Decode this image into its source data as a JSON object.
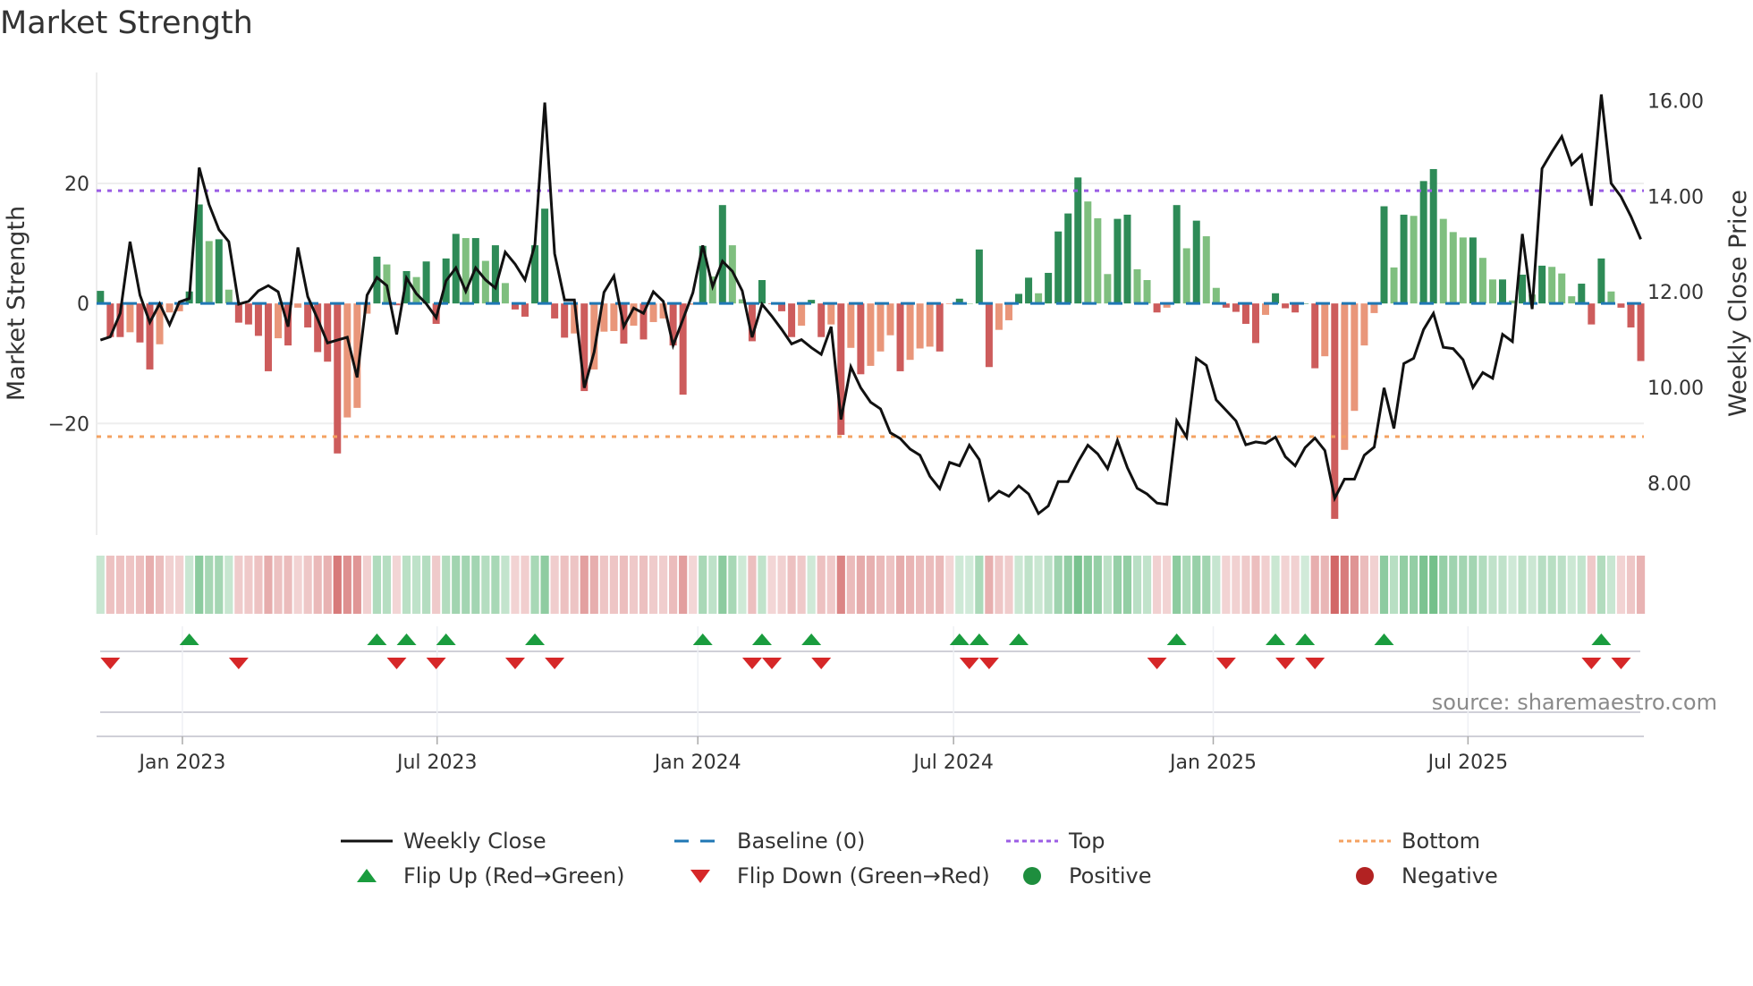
{
  "title": "Market Strength",
  "source": "source: sharemaestro.com",
  "colors": {
    "pos_rising": "#2e8b57",
    "pos_falling": "#7fbf7f",
    "neg_falling": "#cd5c5c",
    "neg_rising": "#e9967a",
    "line": "#111111",
    "baseline": "#1f77b4",
    "top": "#9b5de5",
    "bottom": "#f4a261",
    "flip_up": "#1a9c3e",
    "flip_down": "#d62728",
    "positive": "#1e8e3e",
    "negative": "#b22222"
  },
  "chart_data": {
    "type": "bar+line",
    "title": "Market Strength",
    "ylabel": "Market Strength",
    "y2label": "Weekly Close Price",
    "ylim": [
      -38.6,
      38.5
    ],
    "y2lim": [
      6.91,
      16.59
    ],
    "yticks": [
      {
        "v": 20,
        "label": "20"
      },
      {
        "v": 0,
        "label": "0"
      },
      {
        "v": -20,
        "label": "−20"
      }
    ],
    "y2ticks": [
      {
        "v": 16,
        "label": "16.00"
      },
      {
        "v": 14,
        "label": "14.00"
      },
      {
        "v": 12,
        "label": "12.00"
      },
      {
        "v": 10,
        "label": "10.00"
      },
      {
        "v": 8,
        "label": "8.00"
      }
    ],
    "xticks": [
      {
        "week": 8.3,
        "label": "Jan 2023"
      },
      {
        "week": 34.1,
        "label": "Jul 2023"
      },
      {
        "week": 60.5,
        "label": "Jan 2024"
      },
      {
        "week": 86.4,
        "label": "Jul 2024"
      },
      {
        "week": 112.7,
        "label": "Jan 2025"
      },
      {
        "week": 138.5,
        "label": "Jul 2025"
      }
    ],
    "top_threshold": 18.8,
    "bottom_threshold": -22.2,
    "strength": [
      2.1,
      -5.6,
      -5.6,
      -4.8,
      -6.5,
      -11,
      -6.8,
      -1.5,
      -1.3,
      2,
      16.5,
      10.4,
      10.7,
      2.3,
      -3.2,
      -3.5,
      -5.4,
      -11.3,
      -5.8,
      -7,
      -0.7,
      -4,
      -8.1,
      -9.7,
      -25,
      -19,
      -17.4,
      -1.7,
      7.8,
      6.5,
      -0.3,
      5.4,
      4.4,
      7,
      -3.4,
      7.5,
      11.6,
      10.9,
      10.9,
      7.1,
      9.7,
      3.4,
      -1,
      -2.2,
      9.7,
      15.8,
      -2.5,
      -5.7,
      -5,
      -14.6,
      -11,
      -4.7,
      -4.6,
      -6.7,
      -3.7,
      -6,
      -3.1,
      -2.5,
      -7,
      -15.2,
      -0.2,
      9.6,
      4.5,
      16.4,
      9.7,
      0.7,
      -6.3,
      3.9,
      -0.1,
      -1.3,
      -5.6,
      -3.7,
      0.6,
      -5.6,
      -3.5,
      -21.9,
      -7.4,
      -11.8,
      -10.4,
      -8,
      -5.3,
      -11.3,
      -9.4,
      -7.5,
      -7.2,
      -8,
      -0.1,
      0.8,
      0,
      9,
      -10.6,
      -4.4,
      -2.8,
      1.6,
      4.3,
      1.7,
      5.1,
      12,
      15,
      21,
      17,
      14.2,
      4.9,
      14.1,
      14.8,
      5.7,
      3.9,
      -1.5,
      -0.7,
      16.4,
      9.2,
      13.8,
      11.2,
      2.6,
      -0.7,
      -1.4,
      -3.4,
      -6.6,
      -1.9,
      1.7,
      -0.8,
      -1.5,
      0,
      -10.8,
      -8.8,
      -35.9,
      -24.4,
      -17.9,
      -7,
      -1.6,
      16.2,
      6,
      14.8,
      14.6,
      20.4,
      22.4,
      14.1,
      11.9,
      11,
      11,
      7.6,
      4,
      4,
      0.5,
      4.8,
      1.5,
      6.3,
      6.1,
      5,
      1.2,
      3.3,
      -3.5,
      7.5,
      2,
      -0.7,
      -4,
      -9.6
    ],
    "weekly_close": [
      10.99,
      11.06,
      11.55,
      13.05,
      11.93,
      11.36,
      11.75,
      11.31,
      11.79,
      11.86,
      14.6,
      13.83,
      13.3,
      13.05,
      11.74,
      11.8,
      12.02,
      12.13,
      12.0,
      11.27,
      12.93,
      11.9,
      11.43,
      10.93,
      10.99,
      11.05,
      10.21,
      11.93,
      12.3,
      12.13,
      11.11,
      12.29,
      11.96,
      11.75,
      11.46,
      12.23,
      12.5,
      12.01,
      12.5,
      12.25,
      12.08,
      12.83,
      12.58,
      12.25,
      12.99,
      15.96,
      12.8,
      11.83,
      11.83,
      9.99,
      10.74,
      11.99,
      12.33,
      11.27,
      11.66,
      11.55,
      12.0,
      11.8,
      10.88,
      11.43,
      11.98,
      12.97,
      12.11,
      12.64,
      12.43,
      12.02,
      11.05,
      11.74,
      11.49,
      11.21,
      10.91,
      11.0,
      10.83,
      10.69,
      11.27,
      9.33,
      10.43,
      9.99,
      9.69,
      9.55,
      9.05,
      8.93,
      8.71,
      8.58,
      8.14,
      7.88,
      8.43,
      8.36,
      8.79,
      8.49,
      7.64,
      7.83,
      7.72,
      7.94,
      7.77,
      7.36,
      7.52,
      8.03,
      8.03,
      8.44,
      8.79,
      8.61,
      8.3,
      8.89,
      8.32,
      7.89,
      7.77,
      7.58,
      7.55,
      9.3,
      8.96,
      10.61,
      10.46,
      9.74,
      9.52,
      9.3,
      8.8,
      8.86,
      8.83,
      8.96,
      8.55,
      8.36,
      8.74,
      8.94,
      8.68,
      7.68,
      8.08,
      8.08,
      8.58,
      8.75,
      9.99,
      9.14,
      10.5,
      10.61,
      11.21,
      11.55,
      10.84,
      10.81,
      10.58,
      10.0,
      10.31,
      10.19,
      11.11,
      10.96,
      13.21,
      11.64,
      14.58,
      14.93,
      15.25,
      14.66,
      14.86,
      13.8,
      16.13,
      14.27,
      13.99,
      13.58,
      13.1
    ],
    "flip_up_weeks": [
      9,
      28,
      31,
      35,
      44,
      61,
      67,
      72,
      87,
      89,
      93,
      109,
      119,
      122,
      130,
      152
    ],
    "flip_down_weeks": [
      1,
      14,
      30,
      34,
      42,
      46,
      66,
      68,
      73,
      88,
      90,
      107,
      114,
      120,
      123,
      151,
      154
    ],
    "legend": {
      "placement": "bottom",
      "items": [
        {
          "key": "close",
          "label": "Weekly Close"
        },
        {
          "key": "baseline",
          "label": "Baseline (0)"
        },
        {
          "key": "top",
          "label": "Top"
        },
        {
          "key": "bottom",
          "label": "Bottom"
        },
        {
          "key": "flip_up",
          "label": "Flip Up (Red→Green)"
        },
        {
          "key": "flip_down",
          "label": "Flip Down (Green→Red)"
        },
        {
          "key": "positive",
          "label": "Positive"
        },
        {
          "key": "negative",
          "label": "Negative"
        }
      ]
    }
  }
}
